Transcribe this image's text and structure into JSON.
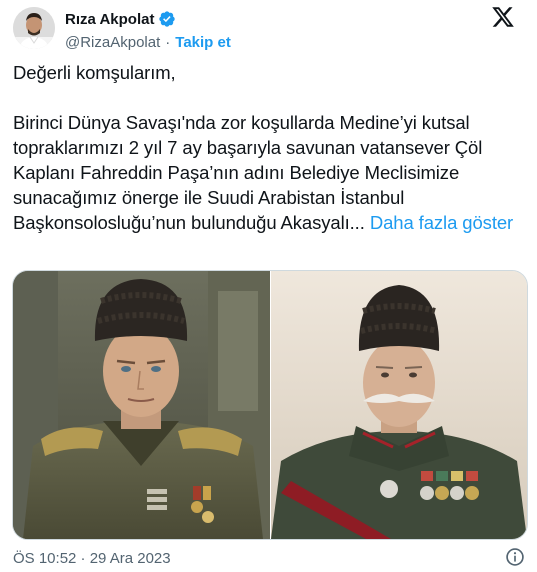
{
  "author": {
    "display_name": "Rıza Akpolat",
    "handle": "@RizaAkpolat",
    "separator": "·",
    "follow_label": "Takip et",
    "avatar_icon": "avatar-portrait",
    "verified_icon": "verified-badge-icon"
  },
  "tweet": {
    "text": "Değerli komşularım,\n\nBirinci Dünya Savaşı'nda zor koşullarda Medine’yi kutsal topraklarımızı 2 yıl 7 ay başarıyla savunan vatansever Çöl Kaplanı Fahreddin Paşa’nın adını Belediye Meclisimize sunacağımız önerge ile Suudi Arabistan İstanbul Başkonsolosluğu’nun bulunduğu Akasyalı... ",
    "show_more_label": "Daha fazla göster"
  },
  "footer": {
    "timestamp": "ÖS 10:52 · 29 Ara 2023"
  },
  "colors": {
    "accent": "#1d9bf0",
    "text": "#0f1419",
    "secondary": "#536471",
    "border": "#cfd9de"
  }
}
